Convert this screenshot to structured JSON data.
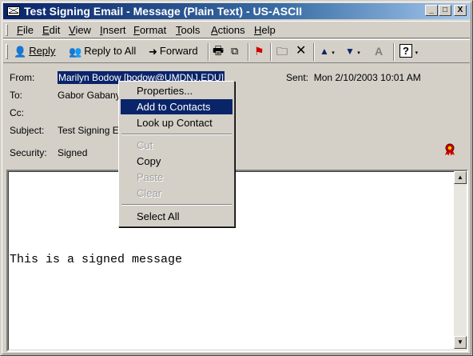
{
  "window": {
    "title": "Test Signing Email - Message (Plain Text)  - US-ASCII",
    "minimize_label": "_",
    "maximize_label": "□",
    "close_label": "X"
  },
  "menubar": {
    "items": [
      "File",
      "Edit",
      "View",
      "Insert",
      "Format",
      "Tools",
      "Actions",
      "Help"
    ]
  },
  "toolbar": {
    "reply": "Reply",
    "reply_all": "Reply to All",
    "forward": "Forward"
  },
  "headers": {
    "from_label": "From:",
    "from_value": "Marilyn Bodow [bodow@UMDNJ.EDU]",
    "to_label": "To:",
    "to_value": "Gabor Gabanyi",
    "cc_label": "Cc:",
    "subject_label": "Subject:",
    "subject_value": "Test Signing Email",
    "security_label": "Security:",
    "security_value": "Signed",
    "sent_label": "Sent:",
    "sent_value": "Mon 2/10/2003 10:01 AM"
  },
  "message": {
    "body": "This is a signed message"
  },
  "context_menu": {
    "properties": "Properties...",
    "add_to_contacts": "Add to Contacts",
    "look_up_contact": "Look up Contact",
    "cut": "Cut",
    "copy": "Copy",
    "paste": "Paste",
    "clear": "Clear",
    "select_all": "Select All"
  },
  "colors": {
    "titlebar": "#0a246a",
    "face": "#d4d0c8",
    "highlight": "#0a246a",
    "seal_red": "#cc0000"
  }
}
